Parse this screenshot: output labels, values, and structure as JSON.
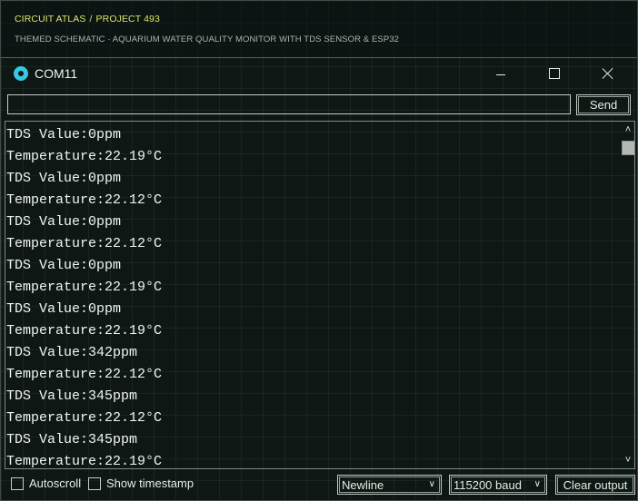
{
  "header": {
    "crumb_site": "CIRCUIT ATLAS",
    "crumb_sep": "/",
    "crumb_project": "PROJECT 493",
    "subtitle": "THEMED SCHEMATIC · AQUARIUM WATER QUALITY MONITOR WITH TDS SENSOR & ESP32"
  },
  "window": {
    "title": "COM11",
    "icon": "serial-monitor-icon",
    "minimize_icon": "minimize-icon",
    "maximize_icon": "maximize-icon",
    "close_icon": "close-icon"
  },
  "send": {
    "input_value": "",
    "button_label": "Send"
  },
  "output": {
    "lines": [
      "TDS Value:0ppm",
      "Temperature:22.19°C",
      "TDS Value:0ppm",
      "Temperature:22.12°C",
      "TDS Value:0ppm",
      "Temperature:22.12°C",
      "TDS Value:0ppm",
      "Temperature:22.19°C",
      "TDS Value:0ppm",
      "Temperature:22.19°C",
      "TDS Value:342ppm",
      "Temperature:22.12°C",
      "TDS Value:345ppm",
      "Temperature:22.12°C",
      "TDS Value:345ppm",
      "Temperature:22.19°C"
    ]
  },
  "footer": {
    "autoscroll_label": "Autoscroll",
    "autoscroll_checked": false,
    "timestamp_label": "Show timestamp",
    "timestamp_checked": false,
    "line_ending": "Newline",
    "baud_rate": "115200 baud",
    "clear_label": "Clear output"
  },
  "colors": {
    "background": "#0e1714",
    "accent_yellow": "#dbe56a",
    "icon_cyan": "#37c8e0",
    "text": "#f2f4f0"
  }
}
